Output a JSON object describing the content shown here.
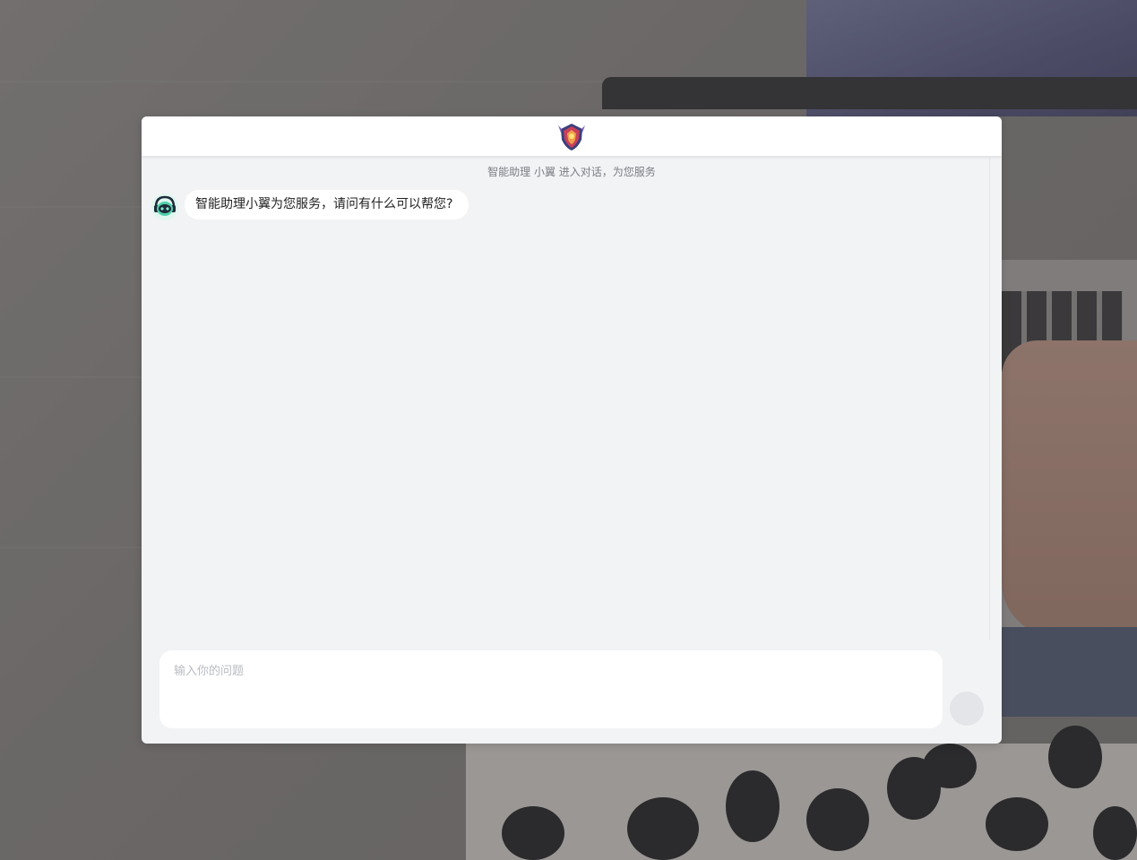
{
  "header": {
    "logo_icon": "shield-emblem-icon"
  },
  "chat": {
    "system_notice": "智能助理 小翼 进入对话，为您服务",
    "messages": [
      {
        "role": "bot",
        "avatar_icon": "robot-headset-icon",
        "text": "智能助理小翼为您服务，请问有什么可以帮您?"
      }
    ]
  },
  "input": {
    "placeholder": "输入你的问题",
    "value": ""
  },
  "send": {
    "icon": "send-icon"
  },
  "colors": {
    "window_bg": "#f2f3f5",
    "header_bg": "#ffffff",
    "bubble_bg": "#ffffff",
    "send_button": "#e4e5e8"
  }
}
